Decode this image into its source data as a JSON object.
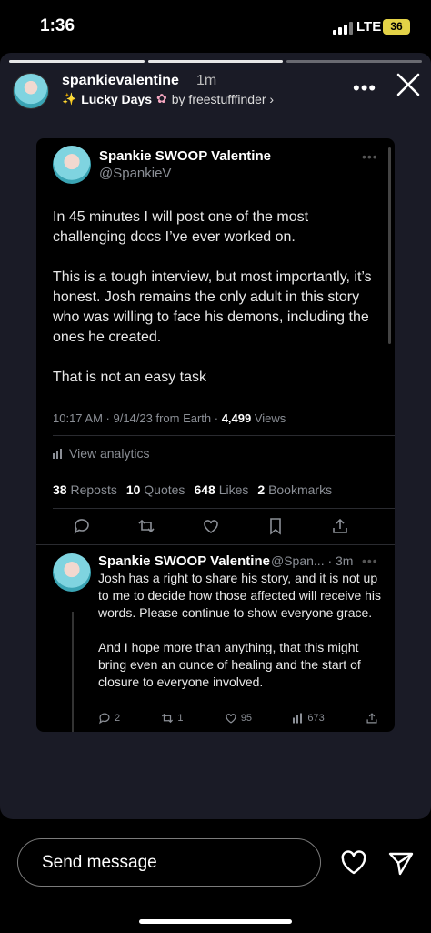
{
  "status_bar": {
    "time": "1:36",
    "network": "LTE",
    "battery": "36"
  },
  "story": {
    "username": "spankievalentine",
    "time_ago": "1m",
    "music": {
      "song": "Lucky Days",
      "artist": "by freestufffinder ›"
    },
    "progress_segments": 3
  },
  "tweet": {
    "name": "Spankie SWOOP Valentine",
    "handle": "@SpankieV",
    "body": [
      "In 45 minutes I will post one of the most challenging docs I’ve ever worked on.",
      "This is a tough interview, but most importantly, it’s honest. Josh remains the only adult in this story who was willing to face his demons, including the ones he created.",
      "That is not an easy task"
    ],
    "timestamp": "10:17 AM · 9/14/23 from Earth · ",
    "views_count": "4,499",
    "views_label": " Views",
    "analytics_label": "View analytics",
    "stats": {
      "reposts_count": "38",
      "reposts_label": "Reposts",
      "quotes_count": "10",
      "quotes_label": "Quotes",
      "likes_count": "648",
      "likes_label": "Likes",
      "bookmarks_count": "2",
      "bookmarks_label": "Bookmarks"
    }
  },
  "reply": {
    "name": "Spankie SWOOP Valentine",
    "handle_time": "@Span... · 3m",
    "body": [
      "Josh has a right to share his story, and it is not up to me to decide how those affected will receive his words. Please continue to show everyone grace.",
      "And I hope more than anything, that this might bring even an ounce of healing and the start of closure to everyone involved."
    ],
    "replies": "2",
    "reposts": "1",
    "likes": "95",
    "views": "673"
  },
  "composer": {
    "placeholder": "Send message"
  }
}
